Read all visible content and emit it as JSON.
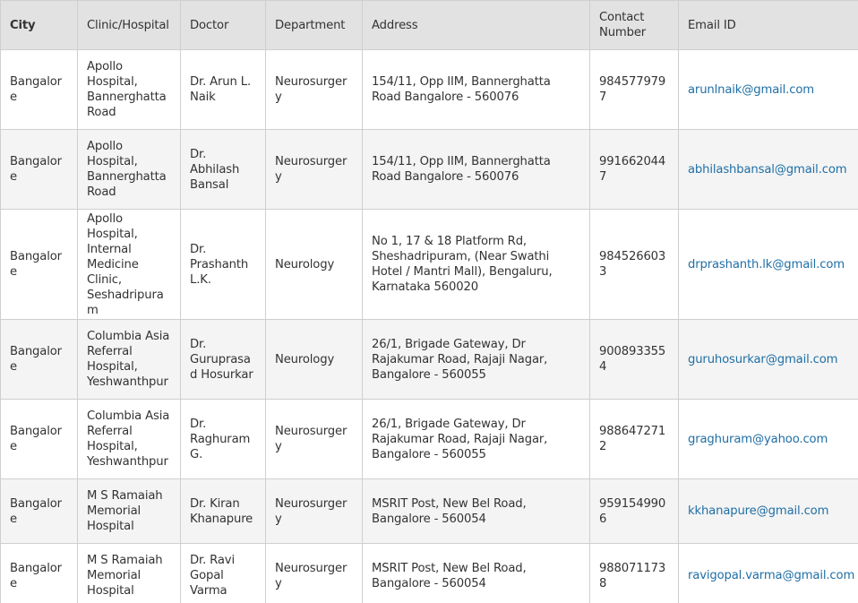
{
  "table": {
    "headers": {
      "city": "City",
      "clinic": "Clinic/Hospital",
      "doctor": "Doctor",
      "department": "Department",
      "address": "Address",
      "contact": "Contact Number",
      "email": "Email ID"
    },
    "rows": [
      {
        "city": "Bangalore",
        "clinic": "Apollo Hospital, Bannerghatta Road",
        "doctor": "Dr. Arun L. Naik",
        "department": "Neurosurgery",
        "address": "154/11, Opp IIM, Bannerghatta Road Bangalore - 560076",
        "contact": "9845779797",
        "email": "arunlnaik@gmail.com"
      },
      {
        "city": "Bangalore",
        "clinic": "Apollo Hospital, Bannerghatta Road",
        "doctor": "Dr. Abhilash Bansal",
        "department": "Neurosurgery",
        "address": "154/11, Opp IIM, Bannerghatta Road Bangalore - 560076",
        "contact": "9916620447",
        "email": "abhilashbansal@gmail.com"
      },
      {
        "city": "Bangalore",
        "clinic": "Apollo Hospital, Internal Medicine Clinic, Seshadripuram",
        "doctor": "Dr. Prashanth L.K.",
        "department": "Neurology",
        "address": "No 1, 17 & 18 Platform Rd, Sheshadripuram, (Near Swathi Hotel / Mantri Mall), Bengaluru, Karnataka 560020",
        "contact": "9845266033",
        "email": "drprashanth.lk@gmail.com"
      },
      {
        "city": "Bangalore",
        "clinic": "Columbia Asia Referral Hospital, Yeshwanthpur",
        "doctor": "Dr. Guruprasad Hosurkar",
        "department": "Neurology",
        "address": "26/1, Brigade Gateway, Dr Rajakumar Road, Rajaji Nagar, Bangalore - 560055",
        "contact": "9008933554",
        "email": "guruhosurkar@gmail.com"
      },
      {
        "city": "Bangalore",
        "clinic": "Columbia Asia Referral Hospital, Yeshwanthpur",
        "doctor": "Dr. Raghuram G.",
        "department": "Neurosurgery",
        "address": "26/1, Brigade Gateway, Dr Rajakumar Road, Rajaji Nagar, Bangalore - 560055",
        "contact": "9886472712",
        "email": "graghuram@yahoo.com"
      },
      {
        "city": "Bangalore",
        "clinic": "M S Ramaiah Memorial Hospital",
        "doctor": "Dr. Kiran Khanapure",
        "department": "Neurosurgery",
        "address": "MSRIT Post, New Bel Road, Bangalore - 560054",
        "contact": "9591549906",
        "email": "kkhanapure@gmail.com"
      },
      {
        "city": "Bangalore",
        "clinic": "M S Ramaiah Memorial Hospital",
        "doctor": "Dr. Ravi Gopal Varma",
        "department": "Neurosurgery",
        "address": "MSRIT Post, New Bel Road, Bangalore - 560054",
        "contact": "9880711738",
        "email": "ravigopal.varma@gmail.com"
      }
    ]
  },
  "colors": {
    "header_bg": "#e2e2e2",
    "row_alt_bg": "#f4f4f4",
    "border": "#cfcfcf",
    "link": "#1f6fa5",
    "text": "#333333"
  }
}
